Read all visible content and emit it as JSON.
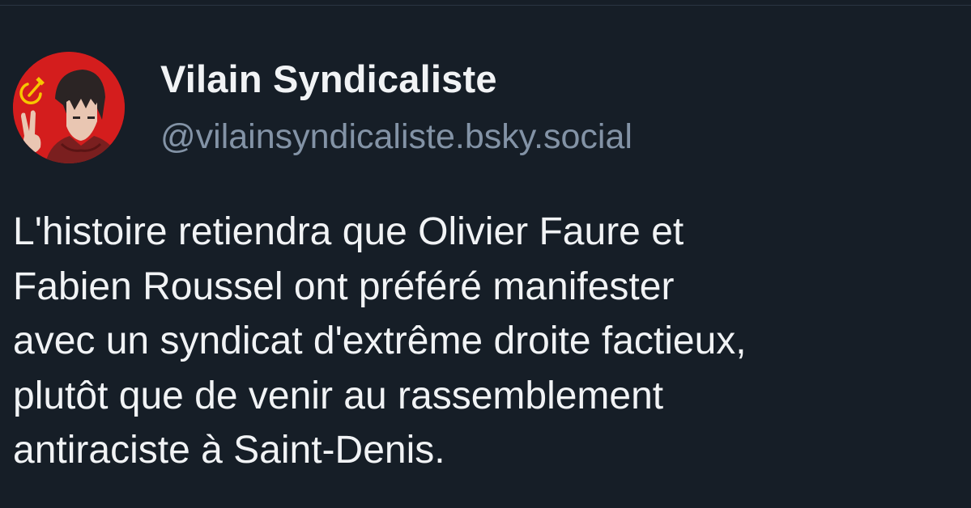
{
  "author": {
    "display_name": "Vilain Syndicaliste",
    "handle": "@vilainsyndicaliste.bsky.social",
    "avatar_icon": "hammer-sickle-avatar-icon"
  },
  "post": {
    "lines": [
      "L'histoire retiendra que Olivier Faure et",
      "Fabien Roussel ont préféré manifester",
      "avec un syndicat d'extrême droite factieux,",
      "plutôt que de venir au rassemblement",
      "antiraciste à Saint-Denis."
    ]
  },
  "colors": {
    "background": "#161e27",
    "text": "#f1f3f5",
    "handle": "#8393a6",
    "avatar_background": "#d41d1d",
    "emblem": "#f7c600"
  }
}
